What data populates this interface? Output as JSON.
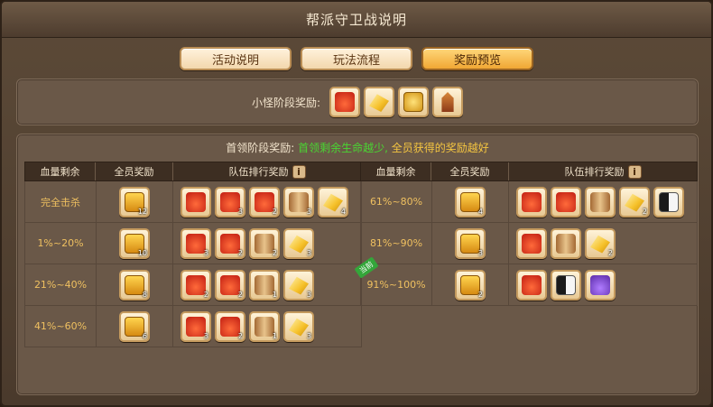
{
  "window": {
    "title": "帮派守卫战说明"
  },
  "tabs": [
    {
      "label": "活动说明",
      "active": false
    },
    {
      "label": "玩法流程",
      "active": false
    },
    {
      "label": "奖励预览",
      "active": true
    }
  ],
  "minion": {
    "label": "小怪阶段奖励:",
    "icons": [
      "lucky-bag-icon",
      "gold-ingot-icon",
      "gold-coin-icon",
      "tower-icon"
    ]
  },
  "boss": {
    "header_prefix": "首领阶段奖励:",
    "header_green": "首领剩余生命越少,",
    "header_yellow": "全员获得的奖励越好",
    "columns": {
      "hp": "血量剩余",
      "all": "全员奖励",
      "rank": "队伍排行奖励",
      "info": "i"
    },
    "current_badge": "当前",
    "left_rows": [
      {
        "hp": "完全击杀",
        "all_qty": "12",
        "rank": [
          {
            "icon": "lucky-bag-icon",
            "qty": ""
          },
          {
            "icon": "lucky-bag-icon",
            "qty": "3"
          },
          {
            "icon": "lucky-bag-icon",
            "qty": "2"
          },
          {
            "icon": "scroll-icon",
            "qty": "3"
          },
          {
            "icon": "gold-ingot-icon",
            "qty": "4"
          }
        ]
      },
      {
        "hp": "1%~20%",
        "all_qty": "10",
        "rank": [
          {
            "icon": "lucky-bag-icon",
            "qty": "3"
          },
          {
            "icon": "lucky-bag-icon",
            "qty": "2"
          },
          {
            "icon": "scroll-icon",
            "qty": "2"
          },
          {
            "icon": "gold-ingot-icon",
            "qty": "3"
          }
        ]
      },
      {
        "hp": "21%~40%",
        "all_qty": "8",
        "rank": [
          {
            "icon": "lucky-bag-icon",
            "qty": "2"
          },
          {
            "icon": "lucky-bag-icon",
            "qty": "2"
          },
          {
            "icon": "scroll-icon",
            "qty": "1"
          },
          {
            "icon": "gold-ingot-icon",
            "qty": "3"
          }
        ]
      },
      {
        "hp": "41%~60%",
        "all_qty": "6",
        "rank": [
          {
            "icon": "lucky-bag-icon",
            "qty": "3"
          },
          {
            "icon": "lucky-bag-icon",
            "qty": "2"
          },
          {
            "icon": "scroll-icon",
            "qty": "1"
          },
          {
            "icon": "gold-ingot-icon",
            "qty": "3"
          }
        ]
      }
    ],
    "right_rows": [
      {
        "hp": "61%~80%",
        "all_qty": "4",
        "current": false,
        "rank": [
          {
            "icon": "lucky-bag-icon",
            "qty": ""
          },
          {
            "icon": "lucky-bag-icon",
            "qty": ""
          },
          {
            "icon": "scroll-icon",
            "qty": ""
          },
          {
            "icon": "gold-ingot-icon",
            "qty": "2"
          },
          {
            "icon": "taiji-icon",
            "qty": ""
          }
        ]
      },
      {
        "hp": "81%~90%",
        "all_qty": "3",
        "current": false,
        "rank": [
          {
            "icon": "lucky-bag-icon",
            "qty": ""
          },
          {
            "icon": "scroll-icon",
            "qty": ""
          },
          {
            "icon": "gold-ingot-icon",
            "qty": "2"
          }
        ]
      },
      {
        "hp": "91%~100%",
        "all_qty": "2",
        "current": true,
        "rank": [
          {
            "icon": "lucky-bag-icon",
            "qty": ""
          },
          {
            "icon": "taiji-icon",
            "qty": ""
          },
          {
            "icon": "potion-icon",
            "qty": ""
          }
        ]
      }
    ]
  }
}
